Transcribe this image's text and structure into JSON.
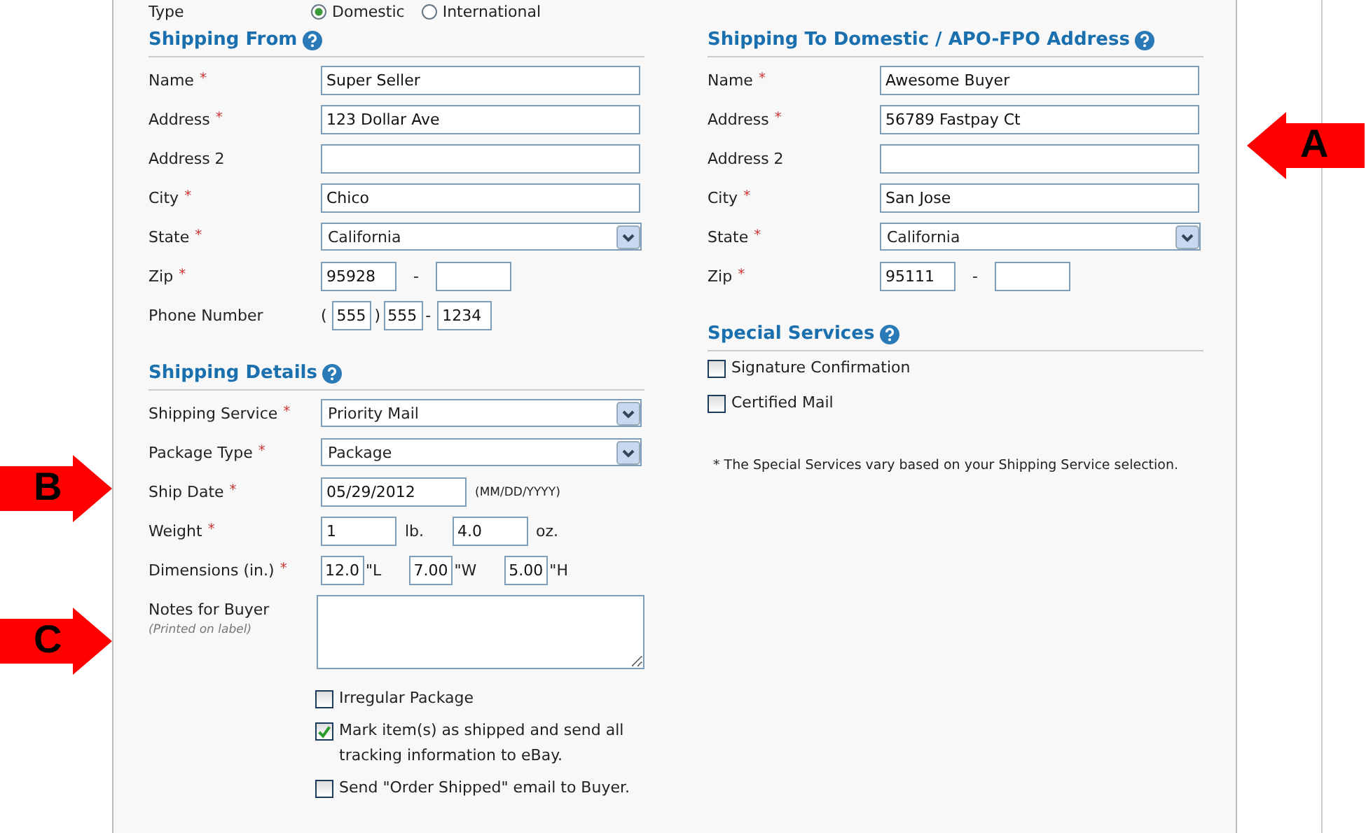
{
  "type_row": {
    "label": "Type",
    "options": [
      {
        "label": "Domestic",
        "selected": true
      },
      {
        "label": "International",
        "selected": false
      }
    ]
  },
  "shipping_from": {
    "title": "Shipping From",
    "rows": [
      {
        "label": "Name",
        "required_mark": "*",
        "kind": "text",
        "value": "Super Seller"
      },
      {
        "label": "Address",
        "required_mark": "*",
        "kind": "text",
        "value": "123 Dollar Ave"
      },
      {
        "label": "Address 2",
        "kind": "text"
      },
      {
        "label": "City",
        "required_mark": "*",
        "kind": "text",
        "value": "Chico"
      },
      {
        "label": "State",
        "required_mark": "*",
        "kind": "select",
        "value": "California"
      },
      {
        "label": "Zip",
        "required_mark": "*",
        "kind": "zip",
        "values": [
          "95928"
        ],
        "separator": "-"
      },
      {
        "label": "Phone Number",
        "kind": "phone",
        "values": [
          "555",
          "555",
          "1234"
        ],
        "open": "(",
        "close": ")",
        "separator": "-"
      }
    ]
  },
  "shipping_to": {
    "title": "Shipping To Domestic / APO-FPO Address",
    "rows": [
      {
        "label": "Name",
        "required_mark": "*",
        "kind": "text",
        "value": "Awesome Buyer"
      },
      {
        "label": "Address",
        "required_mark": "*",
        "kind": "text",
        "value": "56789 Fastpay Ct"
      },
      {
        "label": "Address 2",
        "kind": "text"
      },
      {
        "label": "City",
        "required_mark": "*",
        "kind": "text",
        "value": "San Jose"
      },
      {
        "label": "State",
        "required_mark": "*",
        "kind": "select",
        "value": "California"
      },
      {
        "label": "Zip",
        "required_mark": "*",
        "kind": "zip",
        "values": [
          "95111"
        ],
        "separator": "-"
      }
    ]
  },
  "shipping_details": {
    "title": "Shipping Details",
    "rows": [
      {
        "label": "Shipping Service",
        "required_mark": "*",
        "kind": "select",
        "value": "Priority Mail"
      },
      {
        "label": "Package Type",
        "required_mark": "*",
        "kind": "select",
        "value": "Package"
      },
      {
        "label": "Ship Date",
        "required_mark": "*",
        "kind": "date",
        "value": "05/29/2012",
        "hint": "(MM/DD/YYYY)"
      },
      {
        "label": "Weight",
        "required_mark": "*",
        "kind": "units",
        "parts": [
          {
            "value": "1",
            "unit": "lb."
          },
          {
            "value": "4.0",
            "unit": "oz."
          }
        ]
      },
      {
        "label": "Dimensions (in.)",
        "required_mark": "*",
        "kind": "dims",
        "parts": [
          {
            "value": "12.0",
            "unit": "\"L"
          },
          {
            "value": "7.00",
            "unit": "\"W"
          },
          {
            "value": "5.00",
            "unit": "\"H"
          }
        ]
      },
      {
        "label": "Notes for Buyer",
        "sublabel": "(Printed on label)",
        "kind": "textarea"
      }
    ],
    "checkboxes": [
      {
        "label": "Irregular Package",
        "checked": false
      },
      {
        "label": "Mark item(s) as shipped and send all tracking information to eBay.",
        "checked": true
      },
      {
        "label": "Send \"Order Shipped\" email to Buyer.",
        "checked": false
      }
    ]
  },
  "special_services": {
    "title": "Special Services",
    "checkboxes": [
      {
        "label": "Signature Confirmation",
        "checked": false
      },
      {
        "label": "Certified Mail",
        "checked": false
      }
    ],
    "note": "* The Special Services vary based on your Shipping Service selection."
  },
  "annotations": [
    {
      "letter": "A",
      "kind": "arrow_left"
    },
    {
      "letter": "B",
      "kind": "arrow_right"
    },
    {
      "letter": "C",
      "kind": "arrow_right"
    }
  ]
}
